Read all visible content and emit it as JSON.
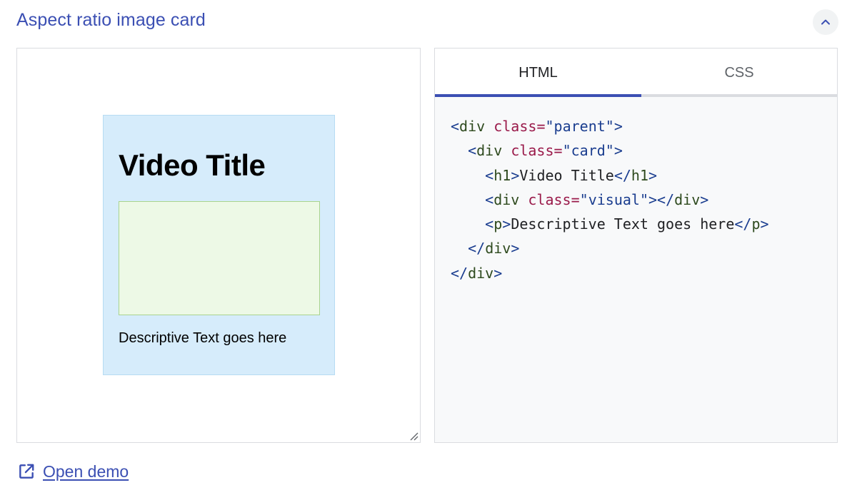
{
  "header": {
    "title": "Aspect ratio image card",
    "collapse_icon": "chevron-up-icon"
  },
  "demo": {
    "card": {
      "title": "Video Title",
      "description": "Descriptive Text goes here"
    },
    "colors": {
      "card_bg": "#d6ecfb",
      "visual_bg": "#edf9e6"
    }
  },
  "code_panel": {
    "tabs": [
      {
        "label": "HTML",
        "active": true
      },
      {
        "label": "CSS",
        "active": false
      }
    ],
    "lines": [
      {
        "indent": "",
        "parts": [
          [
            "punc",
            "<"
          ],
          [
            "tag",
            "div"
          ],
          [
            "",
            ""
          ],
          [
            "",
            " "
          ],
          [
            "attr",
            "class"
          ],
          [
            "attr",
            "="
          ],
          [
            "str",
            "\"parent\""
          ],
          [
            "punc",
            ">"
          ]
        ]
      },
      {
        "indent": "  ",
        "parts": [
          [
            "punc",
            "<"
          ],
          [
            "tag",
            "div"
          ],
          [
            "",
            " "
          ],
          [
            "attr",
            "class"
          ],
          [
            "attr",
            "="
          ],
          [
            "str",
            "\"card\""
          ],
          [
            "punc",
            ">"
          ]
        ]
      },
      {
        "indent": "    ",
        "parts": [
          [
            "punc",
            "<"
          ],
          [
            "tag",
            "h1"
          ],
          [
            "punc",
            ">"
          ],
          [
            "",
            "Video Title"
          ],
          [
            "punc",
            "</"
          ],
          [
            "tag",
            "h1"
          ],
          [
            "punc",
            ">"
          ]
        ]
      },
      {
        "indent": "    ",
        "parts": [
          [
            "punc",
            "<"
          ],
          [
            "tag",
            "div"
          ],
          [
            "",
            " "
          ],
          [
            "attr",
            "class"
          ],
          [
            "attr",
            "="
          ],
          [
            "str",
            "\"visual\""
          ],
          [
            "punc",
            "></"
          ],
          [
            "tag",
            "div"
          ],
          [
            "punc",
            ">"
          ]
        ]
      },
      {
        "indent": "    ",
        "parts": [
          [
            "punc",
            "<"
          ],
          [
            "tag",
            "p"
          ],
          [
            "punc",
            ">"
          ],
          [
            "",
            "Descriptive Text goes here"
          ],
          [
            "punc",
            "</"
          ],
          [
            "tag",
            "p"
          ],
          [
            "punc",
            ">"
          ]
        ]
      },
      {
        "indent": "  ",
        "parts": [
          [
            "punc",
            "</"
          ],
          [
            "tag",
            "div"
          ],
          [
            "punc",
            ">"
          ]
        ]
      },
      {
        "indent": "",
        "parts": [
          [
            "punc",
            "</"
          ],
          [
            "tag",
            "div"
          ],
          [
            "punc",
            ">"
          ]
        ]
      }
    ]
  },
  "footer": {
    "open_demo_label": "Open demo",
    "open_demo_icon": "open-in-new-icon"
  },
  "accent_color": "#3b4fb3"
}
